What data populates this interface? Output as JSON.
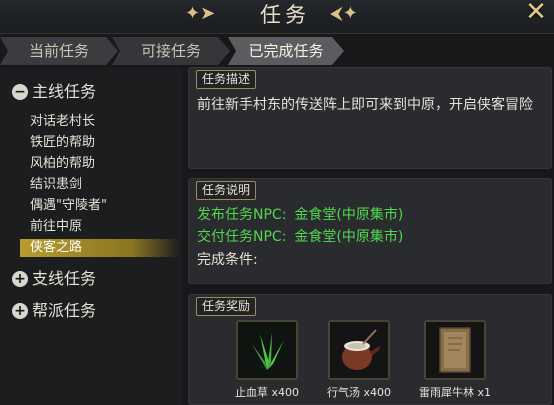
{
  "window": {
    "title": "任务"
  },
  "tabs": [
    "当前任务",
    "可接任务",
    "已完成任务"
  ],
  "sidebar": {
    "main_category": "主线任务",
    "quests": [
      "对话老村长",
      "铁匠的帮助",
      "风柏的帮助",
      "结识患剑",
      "偶遇\"守陵者\"",
      "前往中原",
      "侠客之路"
    ],
    "side_category": "支线任务",
    "guild_category": "帮派任务"
  },
  "description": {
    "title": "任务描述",
    "text": "前往新手村东的传送阵上即可来到中原，开启侠客冒险"
  },
  "info": {
    "title": "任务说明",
    "issuer_label": "发布任务NPC:",
    "issuer_value": "金食堂(中原集市)",
    "deliver_label": "交付任务NPC:",
    "deliver_value": "金食堂(中原集市)",
    "condition_label": "完成条件:"
  },
  "rewards": {
    "title": "任务奖励",
    "items": [
      {
        "name": "止血草 x400",
        "icon": "herb-icon"
      },
      {
        "name": "行气汤 x400",
        "icon": "pot-icon"
      },
      {
        "name": "雷雨犀牛林 x1",
        "icon": "scroll-icon"
      }
    ]
  },
  "colors": {
    "highlight": "#b79c2f",
    "npc_green": "#52d84e",
    "frame_gold": "#a08a55"
  }
}
